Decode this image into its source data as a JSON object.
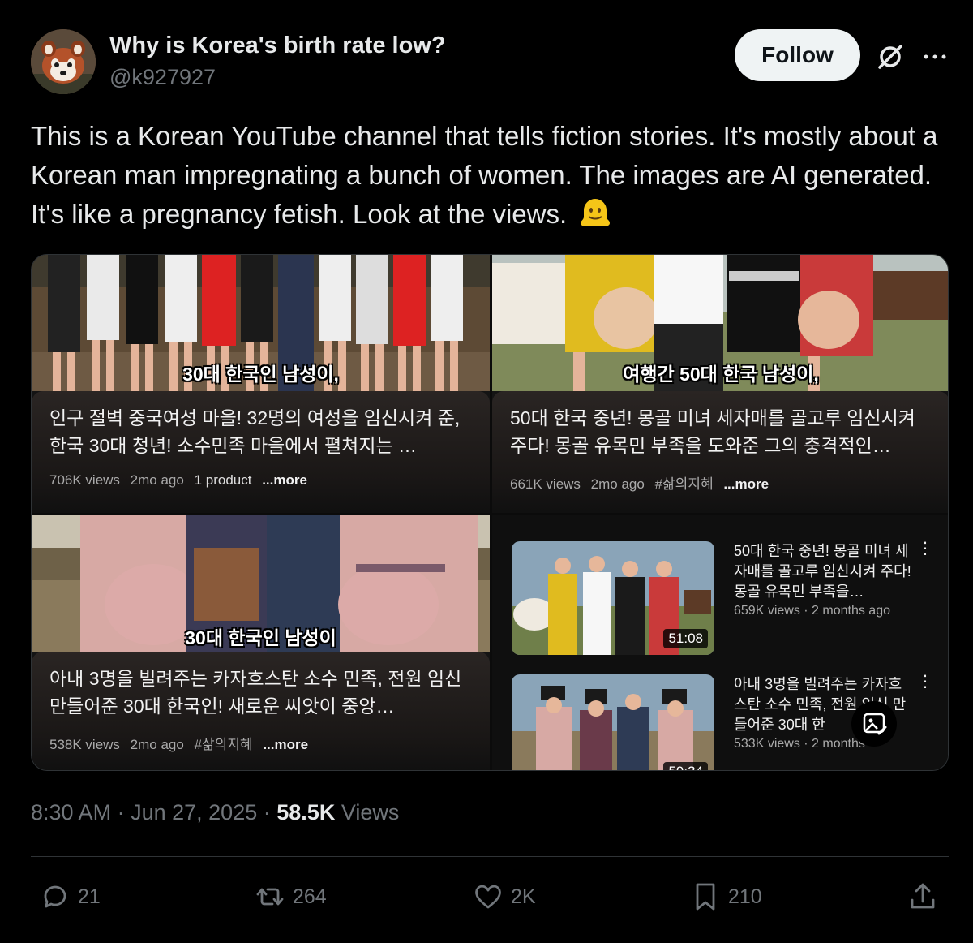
{
  "author": {
    "name": "Why is Korea's birth rate low?",
    "handle": "@k927927"
  },
  "header": {
    "follow_label": "Follow",
    "icons": [
      "grok-icon",
      "more-icon"
    ]
  },
  "tweet": {
    "text": "This is a Korean YouTube channel that tells fiction stories. It's mostly about a Korean man impregnating a bunch of women. The images are AI generated. It's like a pregnancy fetish. Look at the views.",
    "emoji": "melting-face"
  },
  "media": {
    "tiles": [
      {
        "overlay": "30대 한국인 남성이,",
        "title": "인구 절벽 중국여성 마을! 32명의 여성을 임신시켜 준, 한국 30대 청년! 소수민족 마을에서 펼쳐지는 …",
        "views": "706K views",
        "age": "2mo ago",
        "extra": "1 product",
        "more": "...more"
      },
      {
        "overlay": "여행간 50대 한국 남성이,",
        "title": "50대 한국 중년! 몽골 미녀 세자매를 골고루 임신시켜주다! 몽골 유목민 부족을 도와준 그의 충격적인…",
        "views": "661K views",
        "age": "2mo ago",
        "extra": "#삶의지혜",
        "more": "...more"
      },
      {
        "overlay": "30대 한국인 남성이",
        "title": "아내 3명을 빌려주는 카자흐스탄 소수 민족, 전원 임신 만들어준 30대 한국인! 새로운 씨앗이 중앙…",
        "views": "538K views",
        "age": "2mo ago",
        "extra": "#삶의지혜",
        "more": "...more"
      }
    ],
    "related": [
      {
        "title": "50대 한국 중년! 몽골 미녀 세자매를 골고루 임신시켜 주다! 몽골 유목민 부족을…",
        "meta": "659K views · 2 months ago",
        "duration": "51:08"
      },
      {
        "title": "아내 3명을 빌려주는 카자흐스탄 소수 민족, 전원 임신 만들어준 30대 한",
        "meta": "533K views · 2 months",
        "duration": "59:34"
      }
    ]
  },
  "footer": {
    "time": "8:30 AM",
    "date": "Jun 27, 2025",
    "views_count": "58.5K",
    "views_label": "Views",
    "sep": "·"
  },
  "actions": {
    "replies": "21",
    "reposts": "264",
    "likes": "2K",
    "bookmarks": "210"
  },
  "colors": {
    "background": "#000000",
    "text": "#e7e9ea",
    "muted": "#71767b",
    "follow_bg": "#eff3f4",
    "divider": "#2f3336"
  }
}
